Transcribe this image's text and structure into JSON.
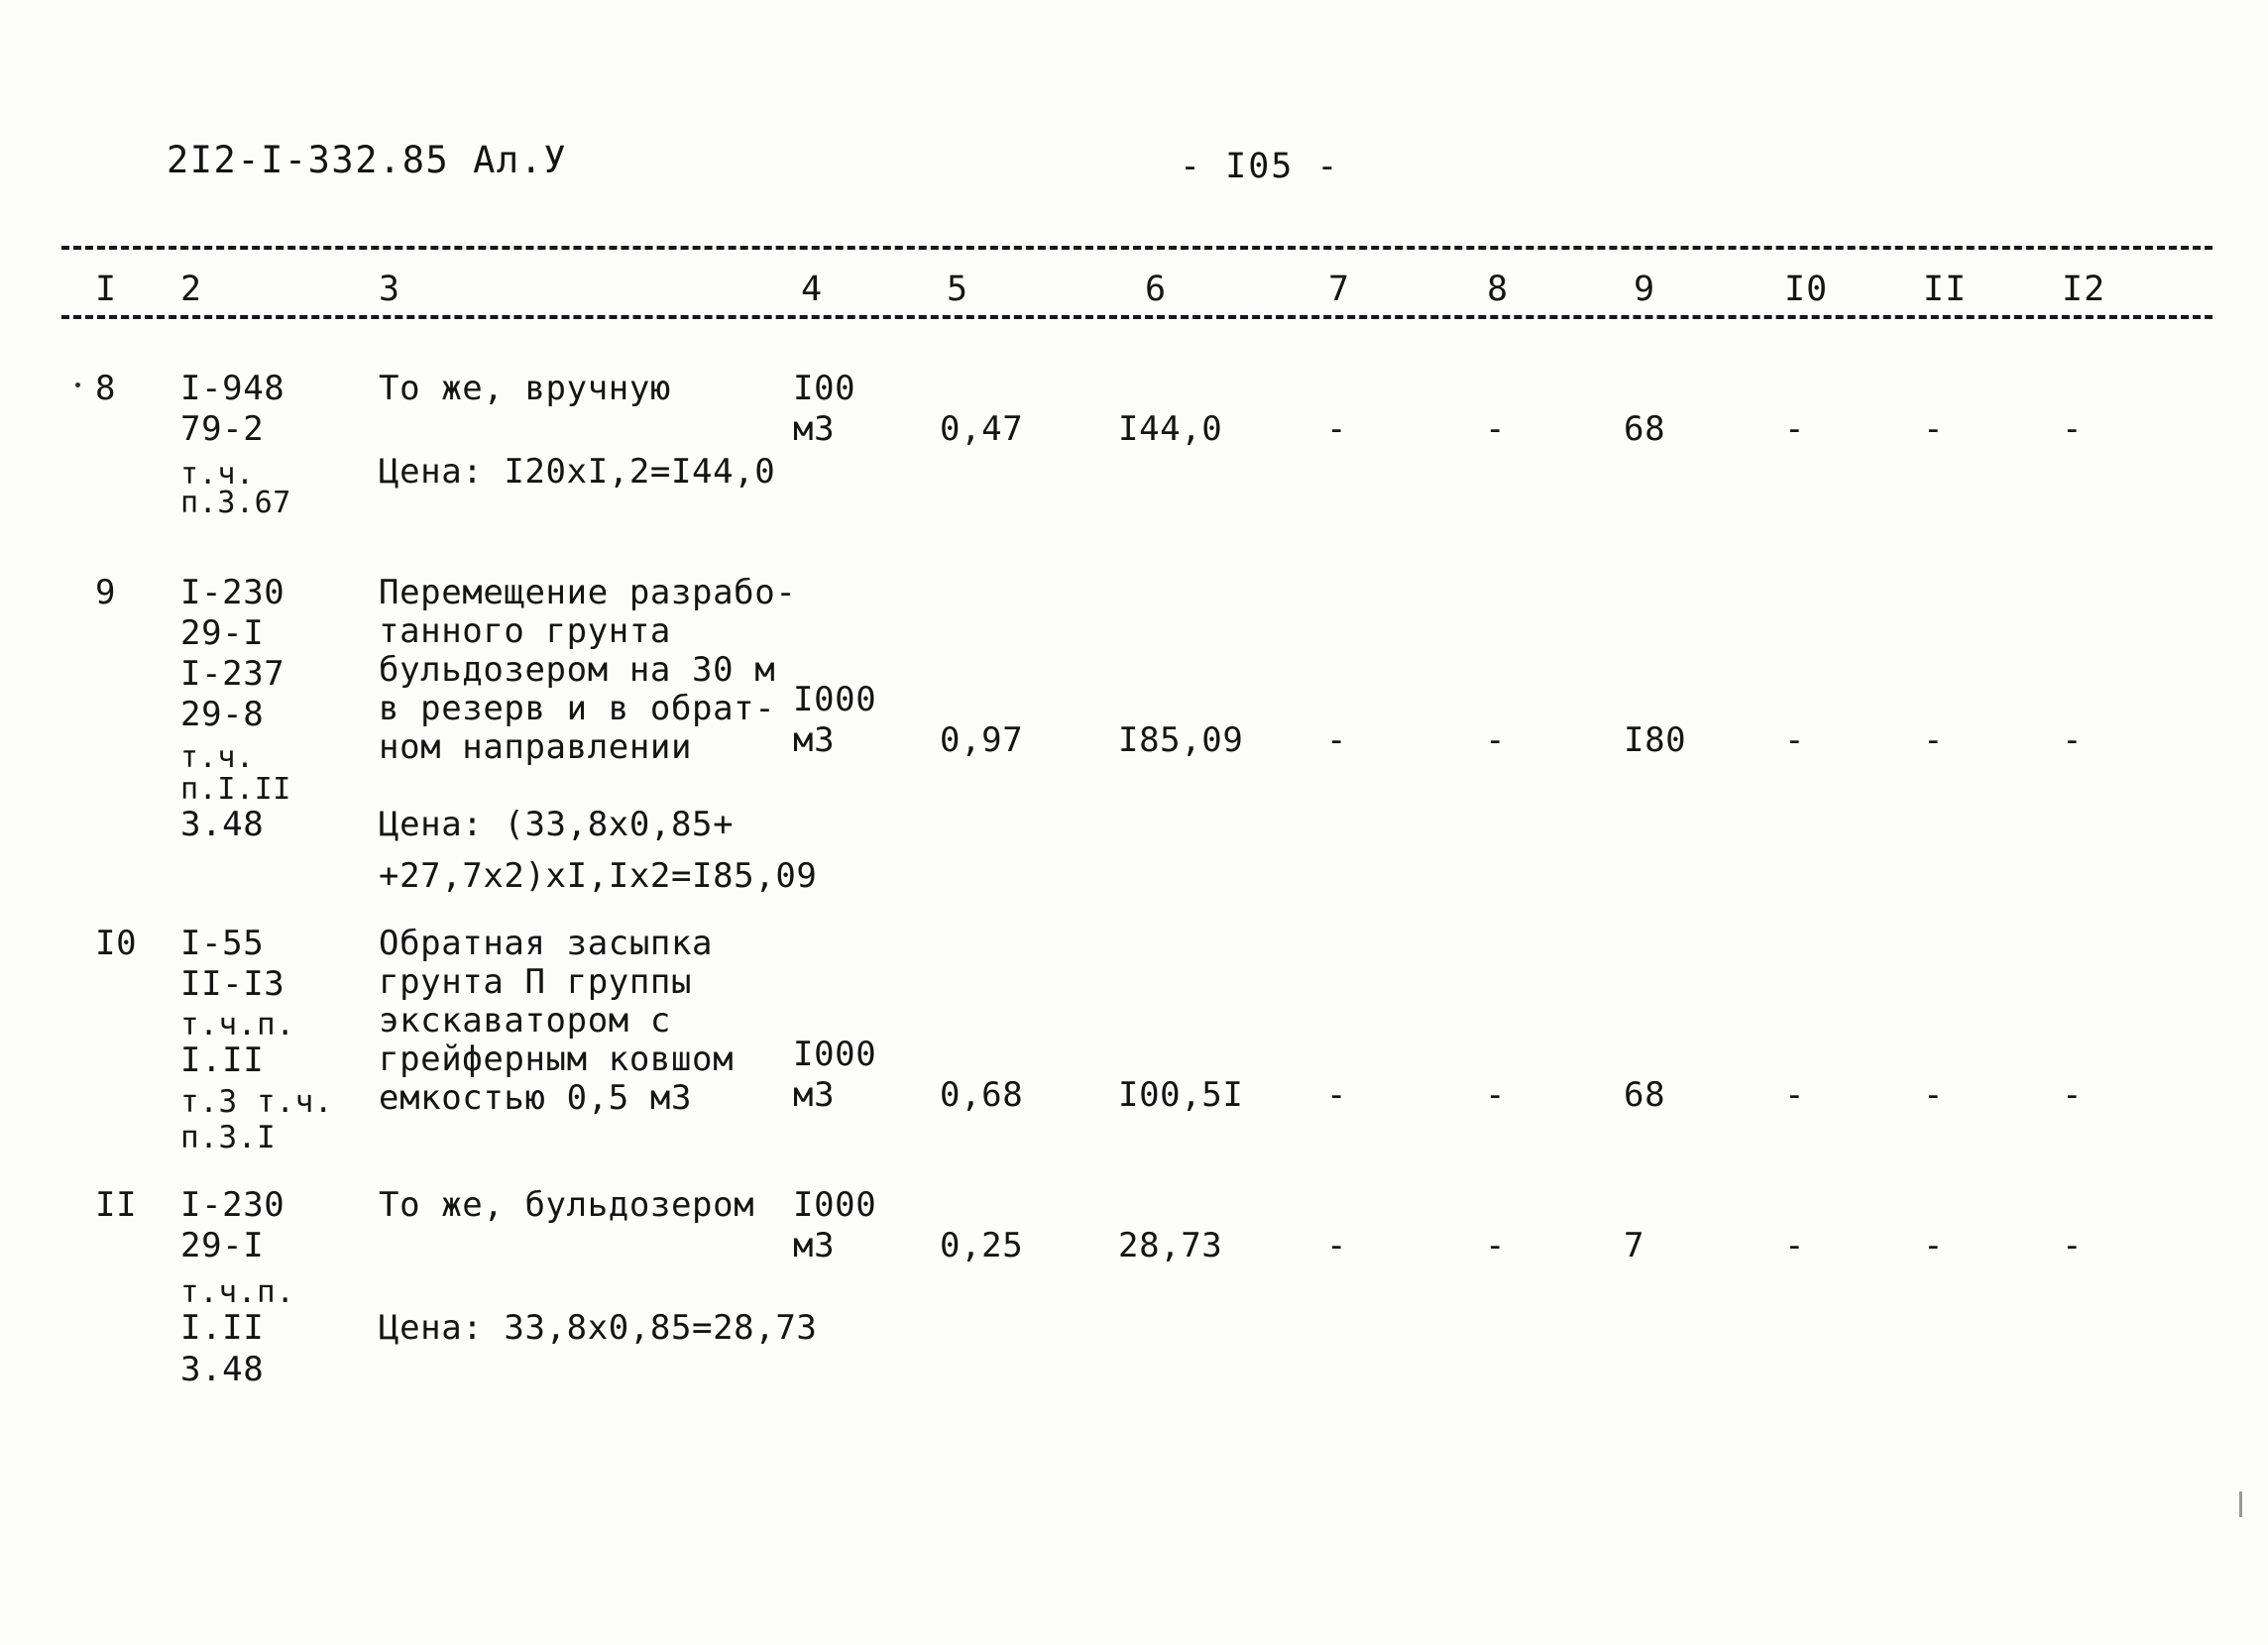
{
  "document": {
    "code": "2I2-I-332.85 Ал.У",
    "page_label": "- I05 -"
  },
  "table": {
    "column_numbers": [
      "I",
      "2",
      "3",
      "4",
      "5",
      "6",
      "7",
      "8",
      "9",
      "I0",
      "II",
      "I2"
    ],
    "rows": [
      {
        "index": "8",
        "code_lines": [
          "I-948",
          "79-2",
          "т.ч.",
          "п.3.67"
        ],
        "description_lines": [
          "То же, вручную"
        ],
        "price_line": "Цена: I20xI,2=I44,0",
        "unit_lines": [
          "I00",
          "м3"
        ],
        "col5": "0,47",
        "col6": "I44,0",
        "col7": "-",
        "col8": "-",
        "col9": "68",
        "col10": "-",
        "col11": "-",
        "col12": "-"
      },
      {
        "index": "9",
        "code_lines": [
          "I-230",
          "29-I",
          "I-237",
          "29-8",
          "т.ч.",
          "п.I.II",
          "3.48"
        ],
        "description_lines": [
          "Перемещение разрабо-",
          "танного грунта",
          "бульдозером на 30 м",
          "в резерв и в обрат-",
          "ном направлении"
        ],
        "price_line": "Цена: (33,8x0,85+",
        "price_line_2": "+27,7x2)xI,Ix2=I85,09",
        "unit_lines": [
          "I000",
          "м3"
        ],
        "col5": "0,97",
        "col6": "I85,09",
        "col7": "-",
        "col8": "-",
        "col9": "I80",
        "col10": "-",
        "col11": "-",
        "col12": "-"
      },
      {
        "index": "I0",
        "code_lines": [
          "I-55",
          "II-I3",
          "т.ч.п.",
          "I.II",
          "т.3 т.ч.",
          "п.3.I"
        ],
        "description_lines": [
          "Обратная засыпка",
          "грунта П группы",
          "экскаватором с",
          "грейферным ковшом",
          "емкостью 0,5 м3"
        ],
        "price_line": "",
        "unit_lines": [
          "I000",
          "м3"
        ],
        "col5": "0,68",
        "col6": "I00,5I",
        "col7": "-",
        "col8": "-",
        "col9": "68",
        "col10": "-",
        "col11": "-",
        "col12": "-"
      },
      {
        "index": "II",
        "code_lines": [
          "I-230",
          "29-I",
          "т.ч.п.",
          "I.II",
          "3.48"
        ],
        "description_lines": [
          "То же, бульдозером"
        ],
        "price_line": "Цена: 33,8x0,85=28,73",
        "unit_lines": [
          "I000",
          "м3"
        ],
        "col5": "0,25",
        "col6": "28,73",
        "col7": "-",
        "col8": "-",
        "col9": "7",
        "col10": "-",
        "col11": "-",
        "col12": "-"
      }
    ]
  }
}
